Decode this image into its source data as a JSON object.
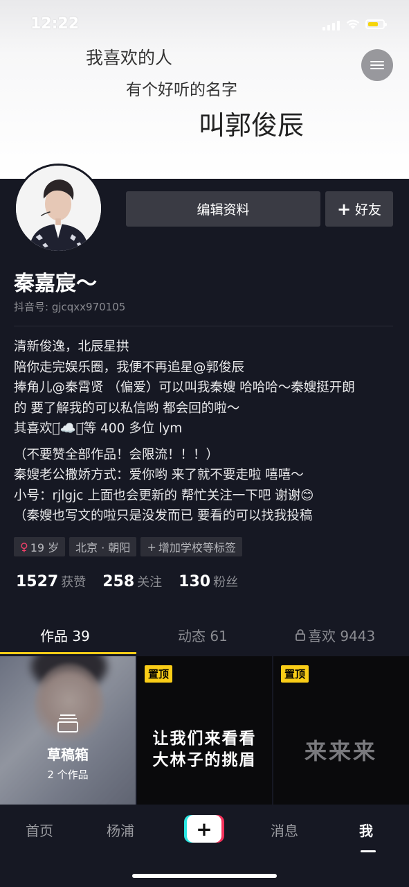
{
  "status_bar": {
    "time": "12:22"
  },
  "banner": {
    "line1": "我喜欢的人",
    "line2": "有个好听的名字",
    "line3": "叫郭俊辰"
  },
  "profile": {
    "edit_label": "编辑资料",
    "add_friend_label": "好友",
    "nickname": "秦嘉宸～",
    "douyin_id": "抖音号: gjcqxx970105",
    "bio_lines": [
      "清新俊逸，北辰星拱",
      "陪你走完娱乐圈，我便不再追星@郭俊辰",
      "捧角儿@秦霄贤 （偏爱）可以叫我秦嫂 哈哈哈～秦嫂挺开朗",
      "的 要了解我的可以私信哟 都会回的啦～",
      "其喜欢德͘☁️社͘等 400 多位 lym",
      "（不要赞全部作品！会限流！！！）",
      "秦嫂老公撒娇方式：爱你哟 来了就不要走啦 嘻嘻～",
      "小号：rjlgjc    上面也会更新的 帮忙关注一下吧 谢谢😊",
      "（秦嫂也写文的啦只是没发而已 要看的可以找我投稿"
    ],
    "tags": {
      "age": "19 岁",
      "location": "北京 · 朝阳",
      "add_school": "增加学校等标签"
    },
    "stats": {
      "likes_num": "1527",
      "likes_label": "获赞",
      "following_num": "258",
      "following_label": "关注",
      "followers_num": "130",
      "followers_label": "粉丝"
    }
  },
  "tabs": {
    "works": "作品 39",
    "dynamics": "动态 61",
    "likes": "喜欢 9443"
  },
  "grid": {
    "draft_title": "草稿箱",
    "draft_count": "2 个作品",
    "pin_label": "置顶",
    "cover2_line1": "让我们来看看",
    "cover2_line2": "大林子的挑眉",
    "cover3_text": "来来来"
  },
  "bottom_nav": {
    "home": "首页",
    "location": "杨浦",
    "plus": "+",
    "messages": "消息",
    "me": "我"
  },
  "colors": {
    "accent": "#facd17",
    "background": "#161823",
    "female": "#f1406a"
  }
}
